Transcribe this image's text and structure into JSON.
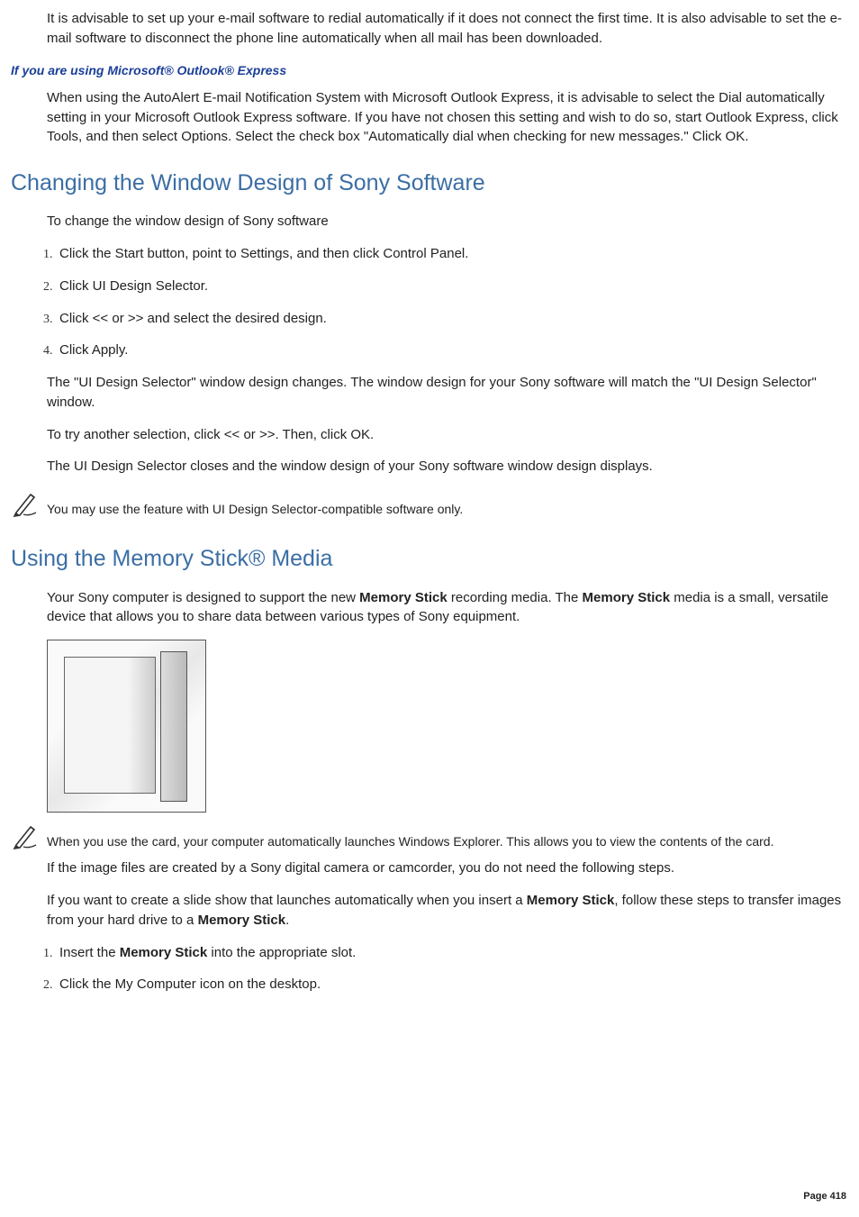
{
  "intro_para": "It is advisable to set up your e-mail software to redial automatically if it does not connect the first time. It is also advisable to set the e-mail software to disconnect the phone line automatically when all mail has been downloaded.",
  "subhead1": "If you are using Microsoft® Outlook® Express",
  "para1": "When using the AutoAlert E-mail Notification System with Microsoft Outlook Express, it is advisable to select the Dial automatically setting in your Microsoft Outlook Express software. If you have not chosen this setting and wish to do so, start Outlook Express, click Tools, and then select Options. Select the check box \"Automatically dial when checking for new messages.\" Click OK.",
  "section1": "Changing the Window Design of Sony Software",
  "para2": "To change the window design of Sony software",
  "steps1": [
    "Click the Start button, point to Settings, and then click Control Panel.",
    "Click UI Design Selector.",
    "Click << or >> and select the desired design.",
    "Click Apply."
  ],
  "para3": "The \"UI Design Selector\" window design changes. The window design for your Sony software will match the \"UI Design Selector\" window.",
  "para4": "To try another selection, click << or >>. Then, click OK.",
  "para5": "The UI Design Selector closes and the window design of your Sony software window design displays.",
  "note1": "You may use the feature with UI Design Selector-compatible software only.",
  "section2": "Using the Memory Stick® Media",
  "para6_pre": "Your Sony computer is designed to support the new ",
  "para6_b1": "Memory Stick",
  "para6_mid": " recording media. The ",
  "para6_b2": "Memory Stick",
  "para6_post": " media is a small, versatile device that allows you to share data between various types of Sony equipment.",
  "note2": "When you use the card, your computer automatically launches Windows Explorer. This allows you to view the contents of the card.",
  "para7": "If the image files are created by a Sony digital camera or camcorder, you do not need the following steps.",
  "para8_pre": "If you want to create a slide show that launches automatically when you insert a ",
  "para8_b1": "Memory Stick",
  "para8_mid": ", follow these steps to transfer images from your hard drive to a ",
  "para8_b2": "Memory Stick",
  "para8_post": ".",
  "steps2_1_pre": "Insert the ",
  "steps2_1_b": "Memory Stick",
  "steps2_1_post": " into the appropriate slot.",
  "steps2_2": "Click the My Computer icon on the desktop.",
  "page_number": "Page 418"
}
